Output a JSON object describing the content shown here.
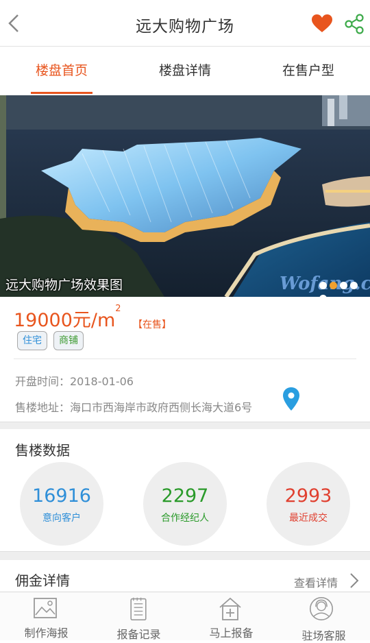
{
  "header": {
    "title": "远大购物广场",
    "back_icon": "back-arrow-icon",
    "favorite_icon": "heart-icon",
    "share_icon": "share-icon",
    "accent_color": "#e8551e"
  },
  "tabs": [
    {
      "label": "楼盘首页",
      "active": true
    },
    {
      "label": "楼盘详情",
      "active": false
    },
    {
      "label": "在售户型",
      "active": false
    }
  ],
  "banner": {
    "caption": "远大购物广场效果图",
    "watermark": "Wofang.com",
    "slide_count": 5,
    "active_slide": 2
  },
  "property": {
    "price": "19000元/m",
    "price_unit_sup": "2",
    "status": "【在售】",
    "tags": [
      "住宅",
      "商铺"
    ],
    "open_date": "开盘时间：2018-01-06",
    "address": "售楼地址：海口市西海岸市政府西侧长海大道6号",
    "location_icon": "map-pin-icon"
  },
  "sales_data": {
    "title": "售楼数据",
    "stats": [
      {
        "value": "16916",
        "label": "意向客户",
        "color": "#2f8fd8"
      },
      {
        "value": "2297",
        "label": "合作经纪人",
        "color": "#2a9a2a"
      },
      {
        "value": "2993",
        "label": "最近成交",
        "color": "#e04030"
      }
    ]
  },
  "commission": {
    "title": "佣金详情",
    "link": "查看详情"
  },
  "tabbar": [
    {
      "label": "制作海报",
      "icon": "image-icon"
    },
    {
      "label": "报备记录",
      "icon": "notepad-icon"
    },
    {
      "label": "马上报备",
      "icon": "house-plus-icon"
    },
    {
      "label": "驻场客服",
      "icon": "customer-service-icon"
    }
  ]
}
